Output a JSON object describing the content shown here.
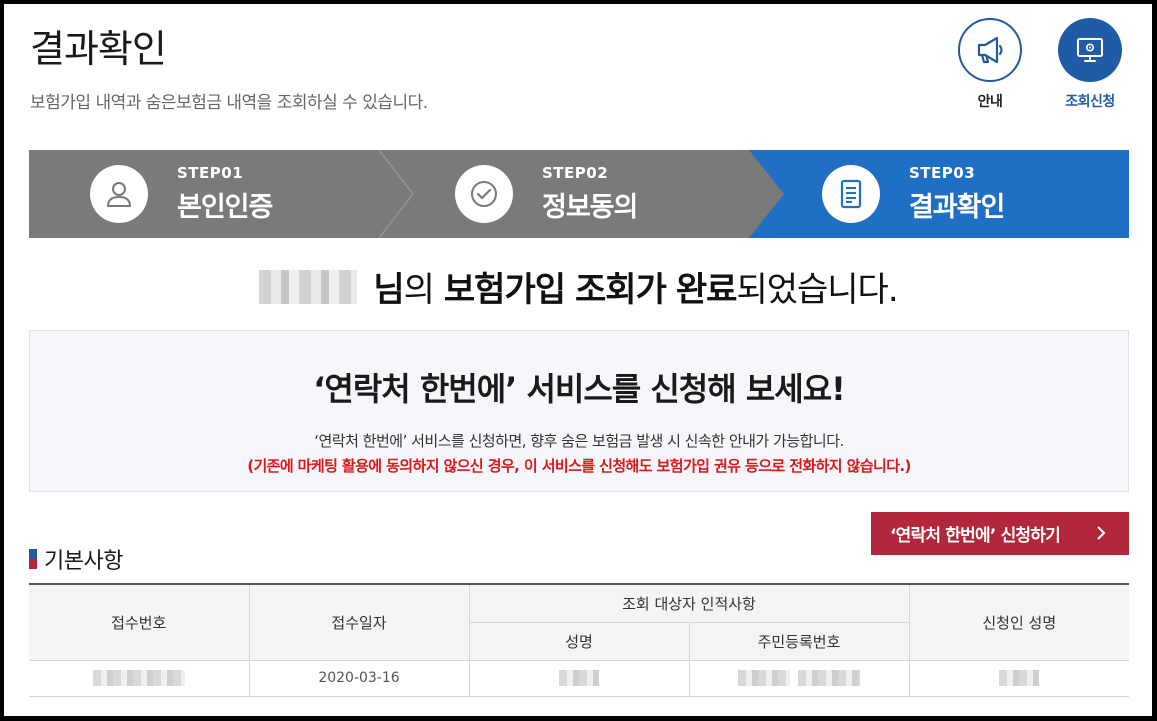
{
  "header": {
    "title": "결과확인",
    "subtitle": "보험가입 내역과 숨은보험금 내역을 조회하실 수 있습니다.",
    "guide_label": "안내",
    "request_label": "조회신청"
  },
  "steps": [
    {
      "num": "STEP01",
      "name": "본인인증",
      "icon": "person-icon"
    },
    {
      "num": "STEP02",
      "name": "정보동의",
      "icon": "check-circle-icon"
    },
    {
      "num": "STEP03",
      "name": "결과확인",
      "icon": "document-icon",
      "active": true
    }
  ],
  "result": {
    "suffix1": "님",
    "particle1": "의",
    "bold1": "보험가입",
    "bold2": "조회가",
    "bold3": "완료",
    "tail": "되었습니다."
  },
  "notice": {
    "title": "‘연락처 한번에’ 서비스를 신청해 보세요!",
    "desc": "‘연락처 한번에’ 서비스를 신청하면, 향후 숨은 보험금 발생 시 신속한 안내가 가능합니다.",
    "warning": "(기존에 마케팅 활용에 동의하지 않으신 경우, 이 서비스를 신청해도 보험가입 권유 등으로 전화하지 않습니다.)"
  },
  "apply_button": "‘연락처 한번에’ 신청하기",
  "section": {
    "title": "기본사항"
  },
  "table": {
    "col_receipt_no": "접수번호",
    "col_receipt_date": "접수일자",
    "col_group": "조회 대상자 인적사항",
    "col_name": "성명",
    "col_rrn": "주민등록번호",
    "col_applicant": "신청인 성명",
    "row": {
      "receipt_date": "2020-03-16"
    }
  },
  "colors": {
    "primary": "#1f5ba6",
    "accent_red": "#b3273d",
    "step_gray": "#7a7a7a",
    "warning": "#e0171b"
  }
}
